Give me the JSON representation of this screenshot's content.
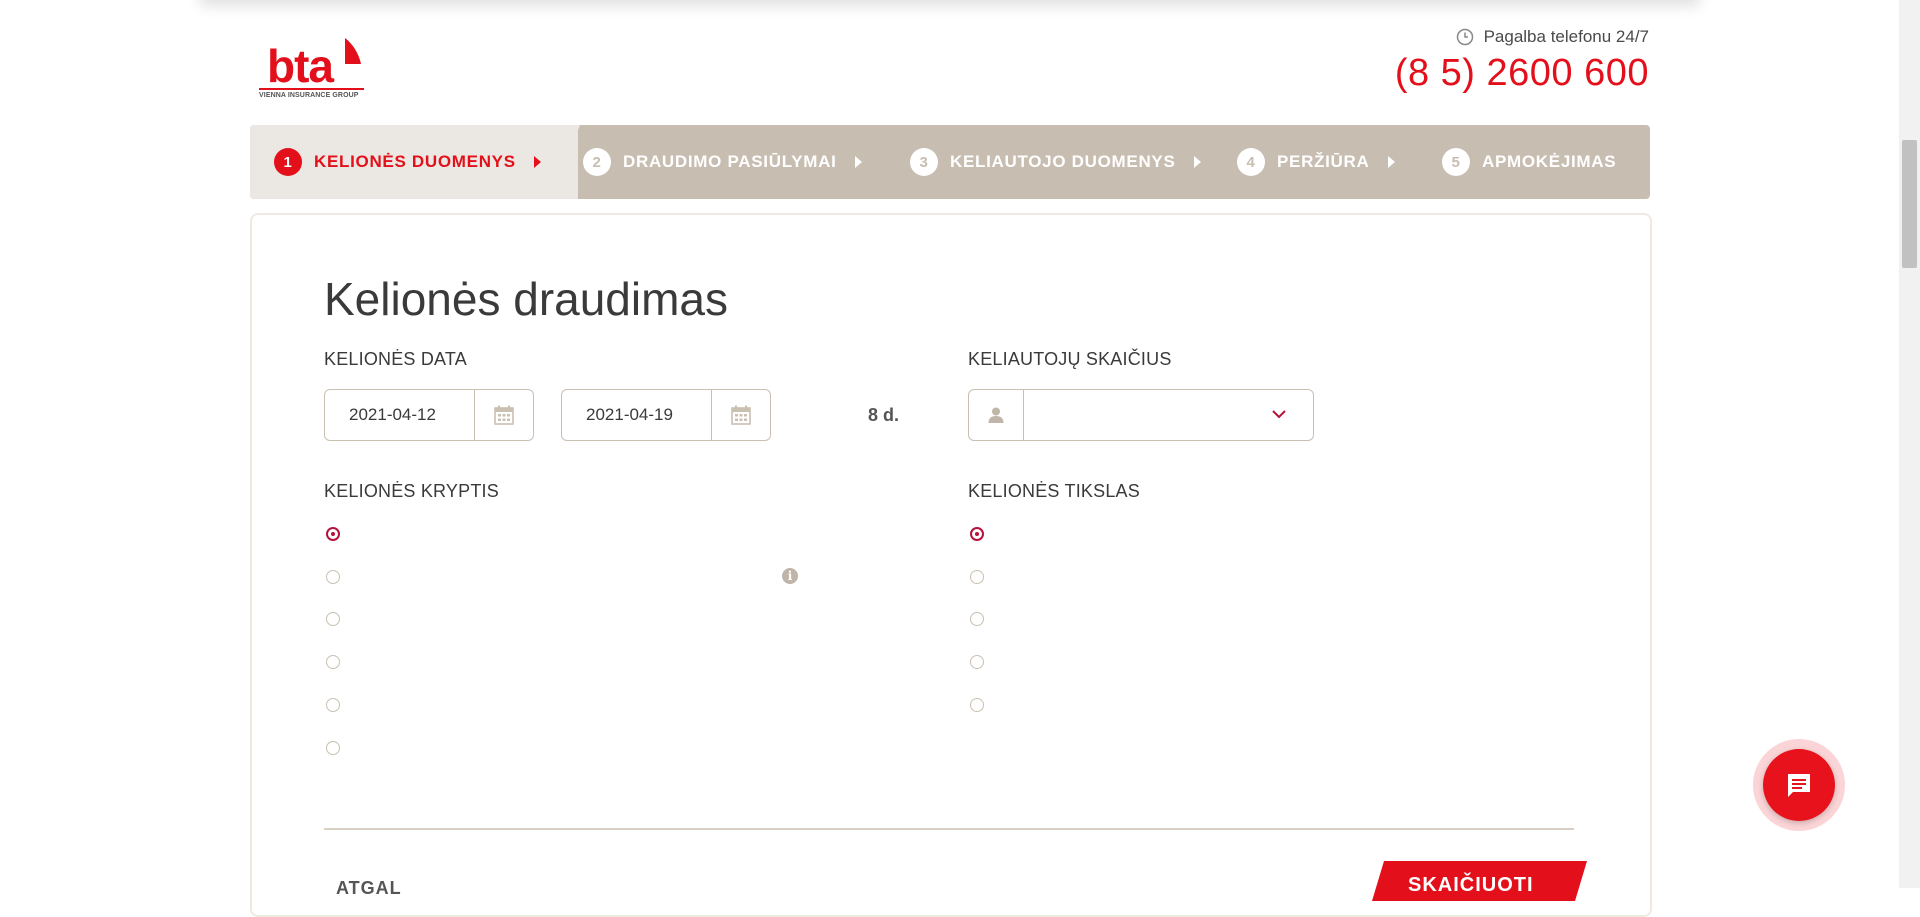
{
  "header": {
    "logo_text": "bta",
    "logo_subtext": "VIENNA INSURANCE GROUP",
    "help_label": "Pagalba telefonu 24/7",
    "phone": "(8 5) 2600 600"
  },
  "stepper": {
    "steps": [
      {
        "num": "1",
        "label": "KELIONĖS DUOMENYS",
        "active": true
      },
      {
        "num": "2",
        "label": "DRAUDIMO PASIŪLYMAI",
        "active": false
      },
      {
        "num": "3",
        "label": "KELIAUTOJO DUOMENYS",
        "active": false
      },
      {
        "num": "4",
        "label": "PERŽIŪRA",
        "active": false
      },
      {
        "num": "5",
        "label": "APMOKĖJIMAS",
        "active": false
      }
    ]
  },
  "form": {
    "title": "Kelionės draudimas",
    "trip_date_label": "KELIONĖS DATA",
    "date_from": "2021-04-12",
    "date_to": "2021-04-19",
    "duration": "8 d.",
    "travelers_label": "KELIAUTOJŲ SKAIČIUS",
    "travelers_value": "",
    "direction_label": "KELIONĖS KRYPTIS",
    "direction_options_count": 6,
    "direction_selected_index": 0,
    "purpose_label": "KELIONĖS TIKSLAS",
    "purpose_options_count": 5,
    "purpose_selected_index": 0
  },
  "actions": {
    "back_label": "ATGAL",
    "calculate_label": "SKAIČIUOTI"
  },
  "colors": {
    "brand_red": "#e3101b",
    "stepper_bg": "#c8bdb1",
    "stepper_active_bg": "#ebe7e2",
    "radio_selected": "#b5123c"
  },
  "icons": [
    "clock-icon",
    "calendar-icon",
    "person-icon",
    "chevron-down-icon",
    "info-icon",
    "chat-icon",
    "caret-right-icon"
  ]
}
